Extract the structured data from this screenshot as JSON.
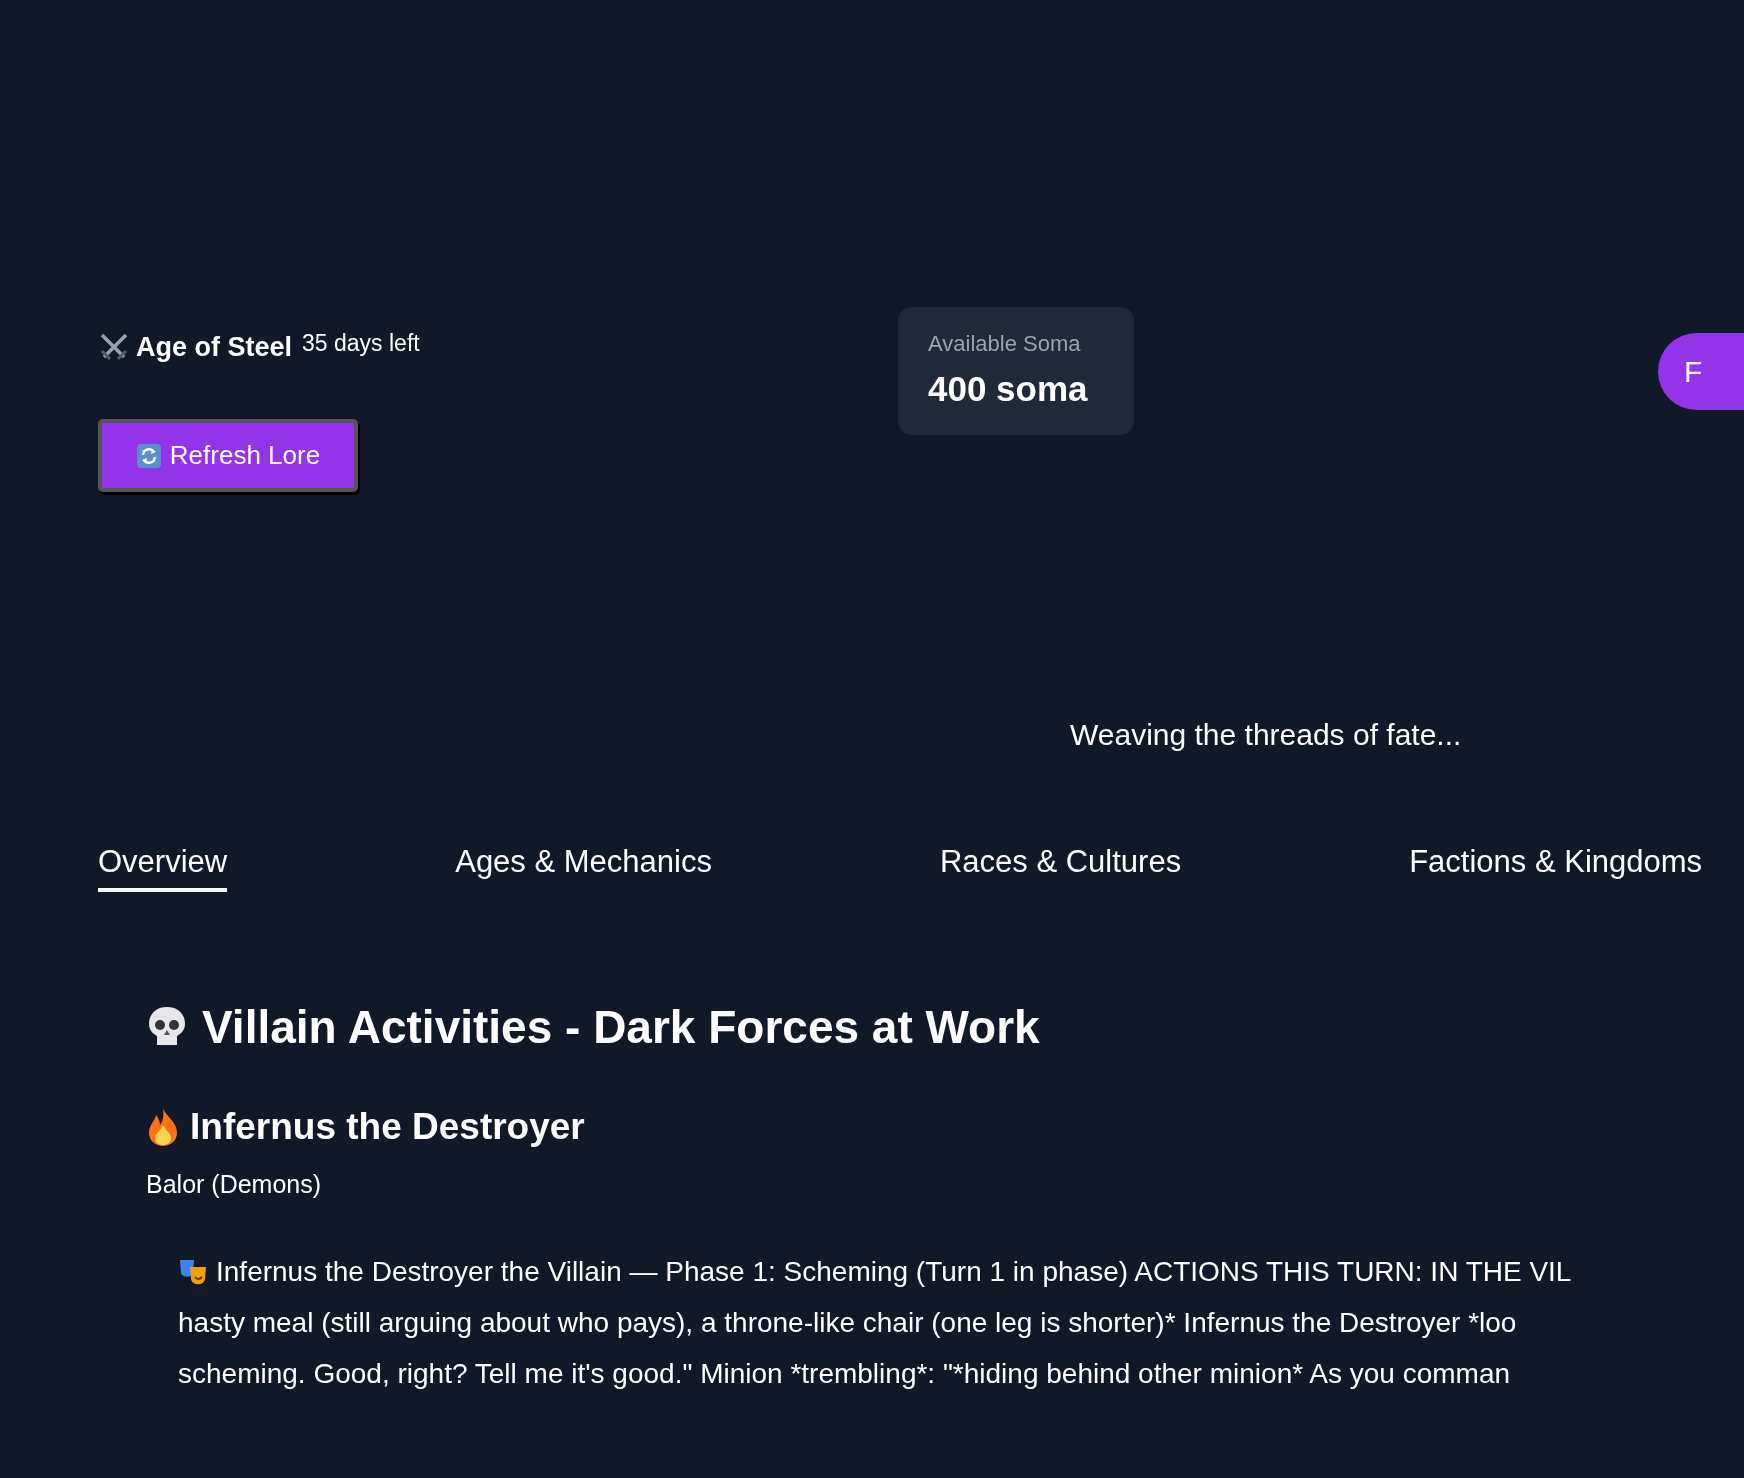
{
  "age": {
    "name": "Age of Steel",
    "remaining": "35 days left"
  },
  "refresh_button": {
    "label": "Refresh Lore"
  },
  "soma": {
    "label": "Available Soma",
    "value": "400 soma"
  },
  "profile_button": {
    "label": "F"
  },
  "loading_text": "Weaving the threads of fate...",
  "tabs": [
    {
      "label": "Overview",
      "selected": true
    },
    {
      "label": "Ages & Mechanics",
      "selected": false
    },
    {
      "label": "Races & Cultures",
      "selected": false
    },
    {
      "label": "Factions & Kingdoms",
      "selected": false
    }
  ],
  "section": {
    "title": "Villain Activities - Dark Forces at Work",
    "villain": {
      "name": "Infernus the Destroyer",
      "race": "Balor (Demons)",
      "lore_lines": [
        "Infernus the Destroyer the Villain — Phase 1: Scheming (Turn 1 in phase) ACTIONS THIS TURN: IN THE VIL",
        "hasty meal (still arguing about who pays), a throne-like chair (one leg is shorter)* Infernus the Destroyer *loo",
        "scheming. Good, right? Tell me it's good.\" Minion *trembling*: \"*hiding behind other minion* As you comman"
      ]
    }
  }
}
